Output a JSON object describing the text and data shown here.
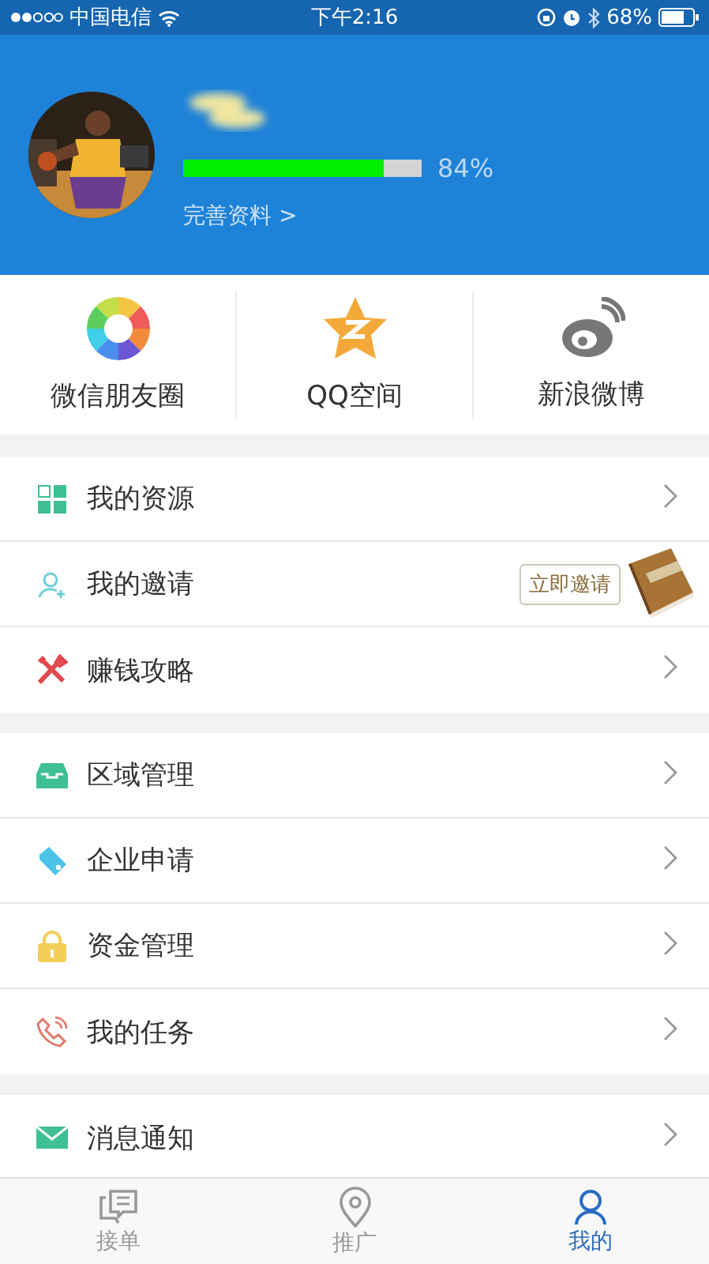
{
  "status_bar": {
    "carrier": "中国电信",
    "time": "下午2:16",
    "battery": "68%"
  },
  "profile": {
    "progress": {
      "level": 0.84,
      "reading": "84%"
    },
    "complete_link": "完善资料 >"
  },
  "share": [
    {
      "kind": "moments",
      "label": "微信朋友圈"
    },
    {
      "kind": "qzone",
      "label": "QQ空间"
    },
    {
      "kind": "weibo",
      "label": "新浪微博"
    }
  ],
  "menu_groups": [
    [
      {
        "kind": "grid",
        "label": "我的资源"
      },
      {
        "kind": "invite",
        "label": "我的邀请",
        "action": "立即邀请"
      },
      {
        "kind": "tools",
        "label": "赚钱攻略"
      }
    ],
    [
      {
        "kind": "inbox",
        "label": "区域管理"
      },
      {
        "kind": "tag",
        "label": "企业申请"
      },
      {
        "kind": "lock",
        "label": "资金管理"
      },
      {
        "kind": "phone",
        "label": "我的任务"
      }
    ],
    [
      {
        "kind": "mail",
        "label": "消息通知"
      }
    ]
  ],
  "tab_bar": [
    {
      "kind": "chat",
      "label": "接单",
      "selected": false
    },
    {
      "kind": "pin",
      "label": "推广",
      "selected": false
    },
    {
      "kind": "person",
      "label": "我的",
      "selected": true
    }
  ]
}
